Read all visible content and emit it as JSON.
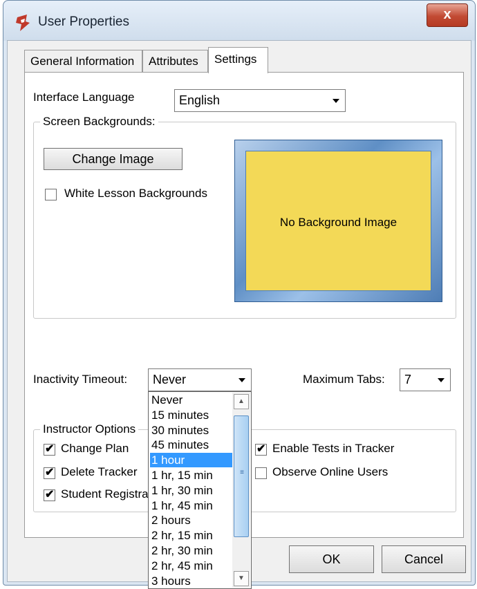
{
  "window": {
    "title": "User Properties",
    "close_glyph": "x",
    "app_icon": "app-logo-icon"
  },
  "tabs": [
    {
      "label": "General Information"
    },
    {
      "label": "Attributes"
    },
    {
      "label": "Settings"
    }
  ],
  "interface_language": {
    "label": "Interface Language",
    "value": "English"
  },
  "backgrounds": {
    "group_title": "Screen Backgrounds:",
    "change_image_label": "Change Image",
    "white_lesson_label": "White Lesson Backgrounds",
    "white_lesson_checked": false,
    "preview_text": "No Background Image"
  },
  "inactivity": {
    "label": "Inactivity Timeout:",
    "value": "Never",
    "options": [
      "Never",
      "15 minutes",
      "30 minutes",
      "45 minutes",
      "1 hour",
      "1 hr, 15 min",
      "1 hr, 30 min",
      "1 hr, 45 min",
      "2 hours",
      "2 hr, 15 min",
      "2 hr, 30 min",
      "2 hr, 45 min",
      "3 hours"
    ],
    "selected_index": 4
  },
  "max_tabs": {
    "label": "Maximum Tabs:",
    "value": "7"
  },
  "instructor": {
    "group_title": "Instructor Options",
    "left": [
      {
        "label": "Change Plan",
        "checked": true
      },
      {
        "label": "Delete Tracker",
        "checked": true
      },
      {
        "label": "Student Registra",
        "checked": true
      }
    ],
    "right": [
      {
        "label": "Enable Tests in Tracker",
        "checked": true
      },
      {
        "label": "Observe Online Users",
        "checked": false
      }
    ]
  },
  "buttons": {
    "ok": "OK",
    "cancel": "Cancel"
  },
  "colors": {
    "selection": "#3399ff",
    "preview_fill": "#f3d957",
    "close_button": "#c24a33"
  }
}
